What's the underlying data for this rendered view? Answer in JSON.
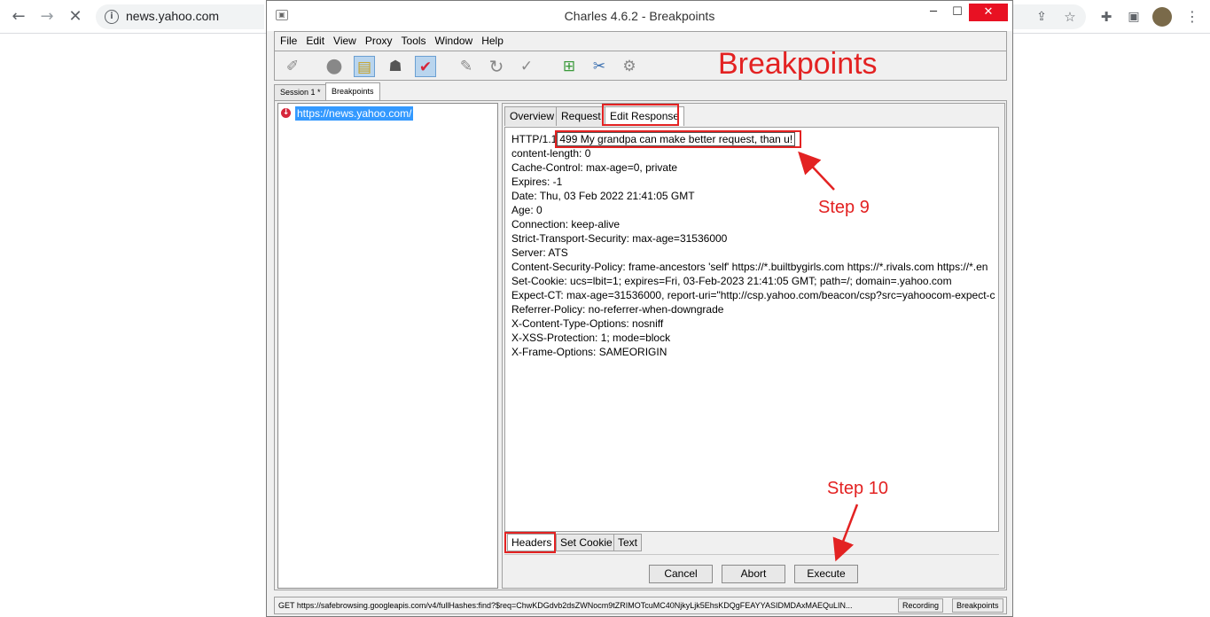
{
  "browser": {
    "url": "news.yahoo.com"
  },
  "window": {
    "title": "Charles 4.6.2 - Breakpoints",
    "minimize": "─",
    "maximize": "☐",
    "close": "✕"
  },
  "menu": [
    "File",
    "Edit",
    "View",
    "Proxy",
    "Tools",
    "Window",
    "Help"
  ],
  "toolbar": {
    "icons": [
      "broom-icon",
      "record-icon",
      "throttle-icon",
      "turtle-icon",
      "breakpoints-toggle-icon",
      "pen-icon",
      "repeat-icon",
      "validate-icon",
      "basket-icon",
      "tools-icon",
      "settings-icon"
    ]
  },
  "annotations": {
    "caption": "Breakpoints",
    "step9": "Step 9",
    "step10": "Step 10"
  },
  "session_tabs": [
    "Session 1 *",
    "Breakpoints"
  ],
  "breakpoint_list": [
    {
      "url": "https://news.yahoo.com/"
    }
  ],
  "detail_tabs": [
    "Overview",
    "Request",
    "Edit Response"
  ],
  "response": {
    "status_prefix": "HTTP/1.1",
    "status_value": "499 My grandpa can make better request, than u!",
    "headers": [
      "content-length: 0",
      "Cache-Control: max-age=0, private",
      "Expires: -1",
      "Date: Thu, 03 Feb 2022 21:41:05 GMT",
      "Age: 0",
      "Connection: keep-alive",
      "Strict-Transport-Security: max-age=31536000",
      "Server: ATS",
      "Content-Security-Policy: frame-ancestors 'self' https://*.builtbygirls.com https://*.rivals.com https://*.en",
      "Set-Cookie: ucs=lbit=1; expires=Fri, 03-Feb-2023 21:41:05 GMT; path=/; domain=.yahoo.com",
      "Expect-CT: max-age=31536000, report-uri=\"http://csp.yahoo.com/beacon/csp?src=yahoocom-expect-c",
      "Referrer-Policy: no-referrer-when-downgrade",
      "X-Content-Type-Options: nosniff",
      "X-XSS-Protection: 1; mode=block",
      "X-Frame-Options: SAMEORIGIN"
    ]
  },
  "bottom_tabs": [
    "Headers",
    "Set Cookie",
    "Text"
  ],
  "actions": {
    "cancel": "Cancel",
    "abort": "Abort",
    "execute": "Execute"
  },
  "statusbar": {
    "text": "GET https://safebrowsing.googleapis.com/v4/fullHashes:find?$req=ChwKDGdvb2dsZWNocm9tZRIMOTcuMC40NjkyLjk5EhsKDQgFEAYYASIDMDAxMAEQuLIN...",
    "recording": "Recording",
    "breakpoints": "Breakpoints"
  }
}
